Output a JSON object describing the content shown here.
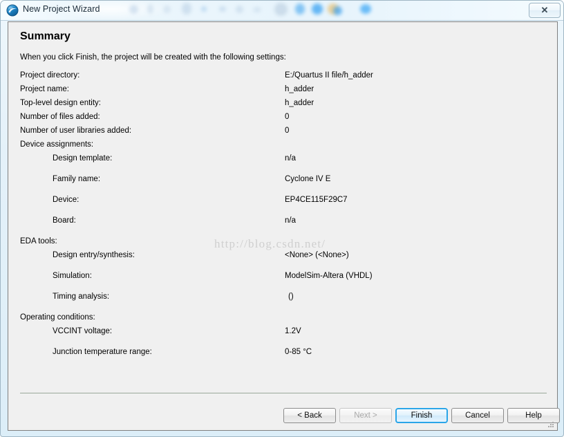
{
  "window": {
    "title": "New Project Wizard",
    "icon": "quartus-sphere-icon",
    "close_label": "✕"
  },
  "page": {
    "title": "Summary",
    "intro": "When you click Finish, the project will be created with the following settings:"
  },
  "summary_rows": [
    {
      "label": "Project directory:",
      "value": "E:/Quartus II file/h_adder",
      "indent": false
    },
    {
      "label": "Project name:",
      "value": "h_adder",
      "indent": false
    },
    {
      "label": "Top-level design entity:",
      "value": "h_adder",
      "indent": false
    },
    {
      "label": "Number of files added:",
      "value": "0",
      "indent": false
    },
    {
      "label": "Number of user libraries added:",
      "value": "0",
      "indent": false
    },
    {
      "label": "Device assignments:",
      "value": "",
      "indent": false
    },
    {
      "label": "Design template:",
      "value": "n/a",
      "indent": true
    },
    {
      "label": "Family name:",
      "value": "Cyclone IV E",
      "indent": true
    },
    {
      "label": "Device:",
      "value": "EP4CE115F29C7",
      "indent": true
    },
    {
      "label": "Board:",
      "value": "n/a",
      "indent": true
    },
    {
      "label": "EDA tools:",
      "value": "",
      "indent": false
    },
    {
      "label": "Design entry/synthesis:",
      "value": "<None> (<None>)",
      "indent": true
    },
    {
      "label": "Simulation:",
      "value": "ModelSim-Altera (VHDL)",
      "indent": true
    },
    {
      "label": "Timing analysis:",
      "value": "()",
      "indent": true,
      "value_indent": true
    },
    {
      "label": "Operating conditions:",
      "value": "",
      "indent": false
    },
    {
      "label": "VCCINT voltage:",
      "value": "1.2V",
      "indent": true
    },
    {
      "label": "Junction temperature range:",
      "value": "0-85 °C",
      "indent": true
    }
  ],
  "watermark": "http://blog.csdn.net/",
  "footer": {
    "back": "< Back",
    "next": "Next >",
    "finish": "Finish",
    "cancel": "Cancel",
    "help": "Help"
  },
  "colors": {
    "accent_blue": "#2aa5e8",
    "panel_bg": "#f0f0f0",
    "titlebar_bg": "#e8f4fb",
    "separator": "#9aa89a",
    "text": "#000000",
    "disabled_text": "#a8a8a8"
  }
}
